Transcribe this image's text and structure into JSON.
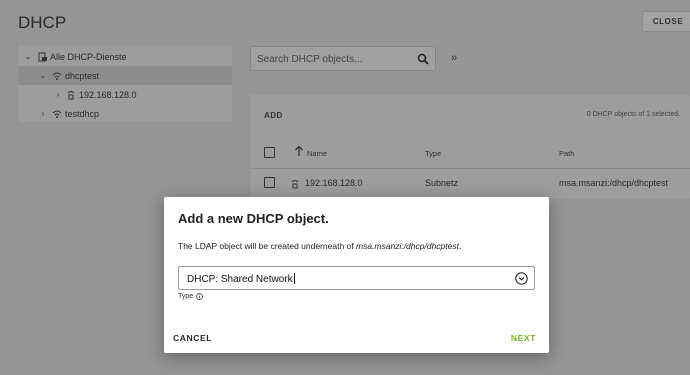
{
  "header": {
    "title": "DHCP",
    "close_label": "CLOSE"
  },
  "tree": {
    "root": "Alle DHCP-Dienste",
    "items": [
      {
        "label": "dhcptest"
      },
      {
        "label": "192.168.128.0"
      },
      {
        "label": "testdhcp"
      }
    ]
  },
  "search": {
    "placeholder": "Search DHCP objects..."
  },
  "grid": {
    "add_label": "ADD",
    "selection_count": "0 DHCP objects of 1 selected.",
    "columns": [
      "Name",
      "Type",
      "Path"
    ],
    "rows": [
      {
        "name": "192.168.128.0",
        "type": "Subnetz",
        "path": "msa.msanzi:/dhcp/dhcptest"
      }
    ]
  },
  "modal": {
    "title": "Add a new DHCP object.",
    "text_prefix": "The LDAP object will be created underneath of ",
    "text_path": "msa.msanzi:/dhcp/dhcptest",
    "text_suffix": ".",
    "select_value": "DHCP: Shared Network",
    "type_label": "Type",
    "cancel_label": "CANCEL",
    "next_label": "NEXT"
  },
  "colors": {
    "accent": "#79b51e",
    "overlay": "#959595"
  }
}
